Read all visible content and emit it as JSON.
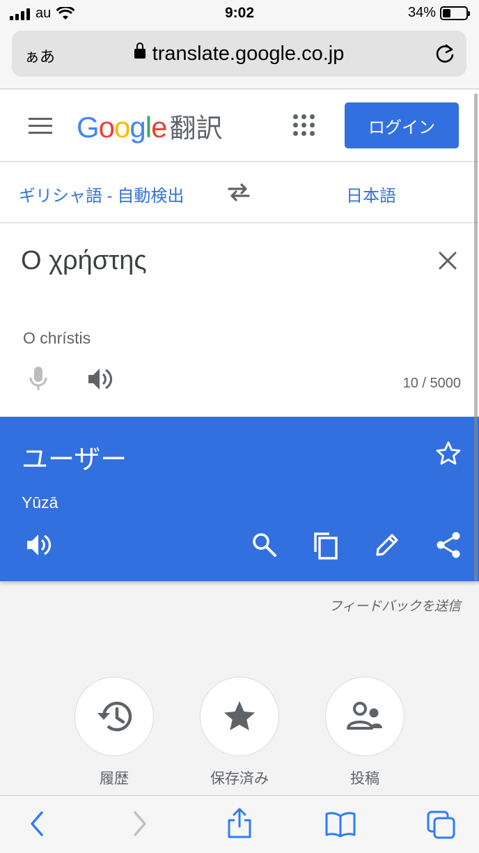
{
  "status": {
    "carrier": "au",
    "time": "9:02",
    "battery": "34%"
  },
  "browser": {
    "aa_label": "ぁあ",
    "url": "translate.google.co.jp"
  },
  "header": {
    "logo_letters": [
      "G",
      "o",
      "o",
      "g",
      "l",
      "e"
    ],
    "logo_colors": [
      "#4285f4",
      "#ea4335",
      "#fbbc05",
      "#4285f4",
      "#34a853",
      "#ea4335"
    ],
    "product": "翻訳",
    "login_label": "ログイン"
  },
  "languages": {
    "source": "ギリシャ語 - 自動検出",
    "target": "日本語"
  },
  "input": {
    "text": "Ο χρήστης",
    "transliteration": "O chrístis",
    "char_count": "10 / 5000"
  },
  "output": {
    "text": "ユーザー",
    "transliteration": "Yūzā"
  },
  "feedback_label": "フィードバックを送信",
  "quick_actions": [
    {
      "label": "履歴",
      "icon": "history-icon"
    },
    {
      "label": "保存済み",
      "icon": "star-icon"
    },
    {
      "label": "投稿",
      "icon": "community-icon"
    }
  ],
  "colors": {
    "accent": "#3370df",
    "link": "#3473d9",
    "icon_gray": "#5f6368"
  }
}
